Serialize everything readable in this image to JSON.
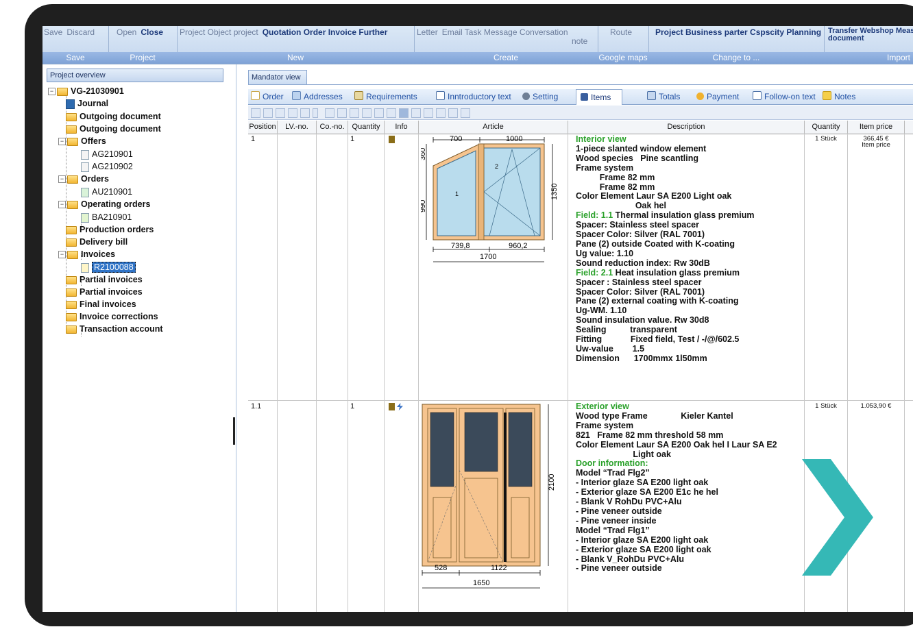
{
  "ribbon": {
    "groups": [
      {
        "buttons": [
          "Save",
          "Discard"
        ],
        "label": "Save"
      },
      {
        "buttons": [
          "Open",
          "Close"
        ],
        "label": "Project"
      },
      {
        "buttons": [
          "Project Object project",
          "Quotation Order Invoice Further"
        ],
        "label": "New"
      },
      {
        "buttons": [
          "Letter",
          "Email Task Message Conversation",
          "note"
        ],
        "label": "Create"
      },
      {
        "buttons": [
          "Route"
        ],
        "label": "Google maps"
      },
      {
        "buttons": [
          "Project Business parter Cspscity Planning"
        ],
        "label": "Change to ..."
      },
      {
        "buttons": [
          "Transfer Webshop Meas",
          "document"
        ],
        "label": "Import"
      }
    ]
  },
  "left": {
    "header": "Project overview",
    "tree": [
      {
        "label": "VG-21030901"
      },
      {
        "label": "Journal"
      },
      {
        "label": "Outgoing document"
      },
      {
        "label": "Outgoing document"
      },
      {
        "label": "Offers"
      },
      {
        "label": "AG210901"
      },
      {
        "label": "AG210902"
      },
      {
        "label": "Orders"
      },
      {
        "label": "AU210901"
      },
      {
        "label": "Operating orders"
      },
      {
        "label": "BA210901"
      },
      {
        "label": "Production orders"
      },
      {
        "label": "Delivery bill"
      },
      {
        "label": "Invoices"
      },
      {
        "label": "R2100088"
      },
      {
        "label": "Partial invoices"
      },
      {
        "label": "Partial invoices"
      },
      {
        "label": "Final invoices"
      },
      {
        "label": "Invoice corrections"
      },
      {
        "label": "Transaction account"
      }
    ]
  },
  "main": {
    "mandator_tab": "Mandator view",
    "tabs": [
      "Order",
      "Addresses",
      "Requirements",
      "Inntroductory text",
      "Setting",
      "Items",
      "Totals",
      "Payment",
      "Follow-on text",
      "Notes"
    ],
    "columns": [
      "Position",
      "LV.-no.",
      "Co.-no.",
      "Quantity",
      "Info",
      "Article",
      "Description",
      "Quantity",
      "Item price"
    ],
    "rows": [
      {
        "position": "1",
        "quantity": "1",
        "qty_unit": "1 Stück",
        "price": "366,45 €",
        "price_label": "Item price",
        "dims": {
          "top_left": "700",
          "top_right": "1000",
          "left_upper": "360",
          "left_lower": "990",
          "right": "1350",
          "bottom_left": "739,8",
          "bottom_right": "960,2",
          "total": "1700",
          "pane1": "1",
          "pane2": "2"
        },
        "desc": [
          {
            "t": "Interior view",
            "s": "g"
          },
          {
            "t": "1-piece slanted window element"
          },
          {
            "t": "Wood species   Pine scantling"
          },
          {
            "t": "Frame system"
          },
          {
            "t": "          Frame 82 mm"
          },
          {
            "t": "          Frame 82 mm"
          },
          {
            "t": "Color Element Laur SA E200 Light oak"
          },
          {
            "t": "                         Oak hel"
          },
          {
            "t": "Field: 1.1",
            "s": "g",
            "rest": " Thermal insulation glass premium"
          },
          {
            "t": "Spacer: Stainless steel spacer"
          },
          {
            "t": "Spacer Color: Silver (RAL 7001)"
          },
          {
            "t": "Pane (2) outside Coated with K-coating"
          },
          {
            "t": "Ug value: 1.10"
          },
          {
            "t": "Sound reduction index: Rw 30dB"
          },
          {
            "t": "Field: 2.1",
            "s": "g",
            "rest": " Heat insulation glass premium"
          },
          {
            "t": "Spacer : Stainless steel spacer"
          },
          {
            "t": "Spacer Color: Silver (RAL 7001)"
          },
          {
            "t": "Pane (2) external coating with K-coating"
          },
          {
            "t": "Ug-WM. 1.10"
          },
          {
            "t": "Sound insulation value. Rw 30d8"
          },
          {
            "t": "Sealing          transparent"
          },
          {
            "t": "Fitting            Fixed field, Test / -/@/602.5"
          },
          {
            "t": "Uw-value        1.5"
          },
          {
            "t": "Dimension      1700mmx 1l50mm"
          }
        ]
      },
      {
        "position": "1.1",
        "quantity": "1",
        "qty_unit": "1 Stück",
        "price": "1.053,90 €",
        "dims": {
          "height": "2100",
          "bottom_left": "528",
          "bottom_right": "1122",
          "total": "1650"
        },
        "desc": [
          {
            "t": "Exterior view",
            "s": "g"
          },
          {
            "t": "Wood type Frame              Kieler Kantel"
          },
          {
            "t": "Frame system"
          },
          {
            "t": "821   Frame 82 mm threshold 58 mm"
          },
          {
            "t": "Color Element Laur SA E200 Oak hel I Laur SA E2"
          },
          {
            "t": "                        Light oak"
          },
          {
            "t": "Door information:",
            "s": "g"
          },
          {
            "t": "Model “Trad Flg2”"
          },
          {
            "t": "- Interior glaze SA E200 light oak"
          },
          {
            "t": "- Exterior glaze SA E200 E1c he hel"
          },
          {
            "t": "- Blank V RohDu PVC+Alu"
          },
          {
            "t": "- Pine veneer outside"
          },
          {
            "t": "- Pine veneer inside"
          },
          {
            "t": "Model “Trad Flg1”"
          },
          {
            "t": "- Interior glaze SA E200 light oak"
          },
          {
            "t": "- Exterior glaze SA E200 light oak"
          },
          {
            "t": "- Blank V_RohDu PVC+Alu"
          },
          {
            "t": "- Pine veneer outside"
          }
        ]
      }
    ]
  },
  "colors": {
    "ribbon_label": "#7ea2d6",
    "accent_text": "#2aa12a",
    "chevron": "#35b8b6",
    "frame_wood": "#f6c48f",
    "selection": "#2f73c6"
  }
}
